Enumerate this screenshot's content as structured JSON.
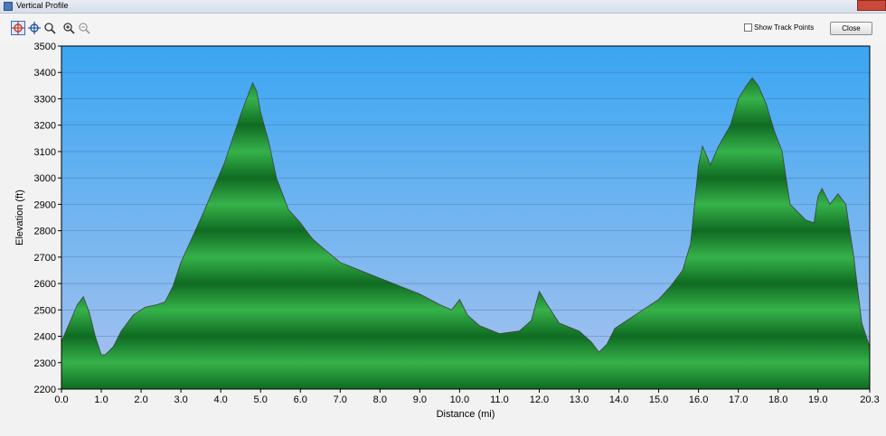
{
  "window": {
    "title": "Vertical Profile"
  },
  "toolbar": {
    "tools": [
      {
        "name": "select-tool-icon",
        "active": true
      },
      {
        "name": "pan-tool-icon",
        "active": false
      },
      {
        "name": "zoom-box-tool-icon",
        "active": false
      },
      {
        "name": "zoom-in-icon",
        "active": false
      },
      {
        "name": "zoom-out-icon",
        "active": false
      }
    ],
    "show_track_points_label": "Show Track Points",
    "close_label": "Close"
  },
  "colors": {
    "sky_top": "#3aa6f2",
    "sky_bottom": "#a9c3ee",
    "terrain": "#1f9a36",
    "terrain_dark": "#0f6b22",
    "outline": "#404040"
  },
  "chart_data": {
    "type": "area",
    "title": "",
    "xlabel": "Distance   (mi)",
    "ylabel": "Elevation (ft)",
    "xlim": [
      0,
      20.3
    ],
    "ylim": [
      2200,
      3500
    ],
    "xticks": [
      "0.0",
      "1.0",
      "2.0",
      "3.0",
      "4.0",
      "5.0",
      "6.0",
      "7.0",
      "8.0",
      "9.0",
      "10.0",
      "11.0",
      "12.0",
      "13.0",
      "14.0",
      "15.0",
      "16.0",
      "17.0",
      "18.0",
      "19.0",
      "20.3"
    ],
    "yticks": [
      "3500",
      "3400",
      "3300",
      "3200",
      "3100",
      "3000",
      "2900",
      "2800",
      "2700",
      "2600",
      "2500",
      "2400",
      "2300",
      "2200"
    ],
    "grid": true,
    "series": [
      {
        "x": [
          0.0,
          0.2,
          0.4,
          0.55,
          0.7,
          0.85,
          1.0,
          1.1,
          1.3,
          1.5,
          1.8,
          2.1,
          2.4,
          2.6,
          2.8,
          3.0,
          3.3,
          3.6,
          3.9,
          4.1,
          4.3,
          4.5,
          4.7,
          4.8,
          4.9,
          5.0,
          5.2,
          5.4,
          5.7,
          6.0,
          6.3,
          6.6,
          7.0,
          7.5,
          8.0,
          8.5,
          9.0,
          9.5,
          9.8,
          10.0,
          10.2,
          10.5,
          11.0,
          11.5,
          11.8,
          12.0,
          12.2,
          12.5,
          13.0,
          13.3,
          13.5,
          13.7,
          13.9,
          14.2,
          14.6,
          15.0,
          15.3,
          15.6,
          15.8,
          16.0,
          16.1,
          16.3,
          16.5,
          16.8,
          17.0,
          17.2,
          17.35,
          17.5,
          17.7,
          17.9,
          18.1,
          18.3,
          18.5,
          18.7,
          18.9,
          19.0,
          19.1,
          19.3,
          19.5,
          19.7,
          19.9,
          20.1,
          20.3
        ],
        "values": [
          2380,
          2450,
          2520,
          2550,
          2490,
          2400,
          2330,
          2330,
          2360,
          2420,
          2480,
          2510,
          2520,
          2530,
          2590,
          2680,
          2780,
          2880,
          2990,
          3060,
          3150,
          3240,
          3320,
          3360,
          3330,
          3250,
          3140,
          3000,
          2880,
          2830,
          2770,
          2730,
          2680,
          2650,
          2620,
          2590,
          2560,
          2520,
          2500,
          2540,
          2480,
          2440,
          2410,
          2420,
          2460,
          2570,
          2520,
          2450,
          2420,
          2380,
          2340,
          2370,
          2430,
          2460,
          2500,
          2540,
          2590,
          2650,
          2750,
          3050,
          3120,
          3050,
          3120,
          3200,
          3300,
          3350,
          3380,
          3350,
          3280,
          3180,
          3100,
          2900,
          2870,
          2840,
          2830,
          2930,
          2960,
          2900,
          2940,
          2900,
          2700,
          2450,
          2360
        ]
      }
    ]
  }
}
